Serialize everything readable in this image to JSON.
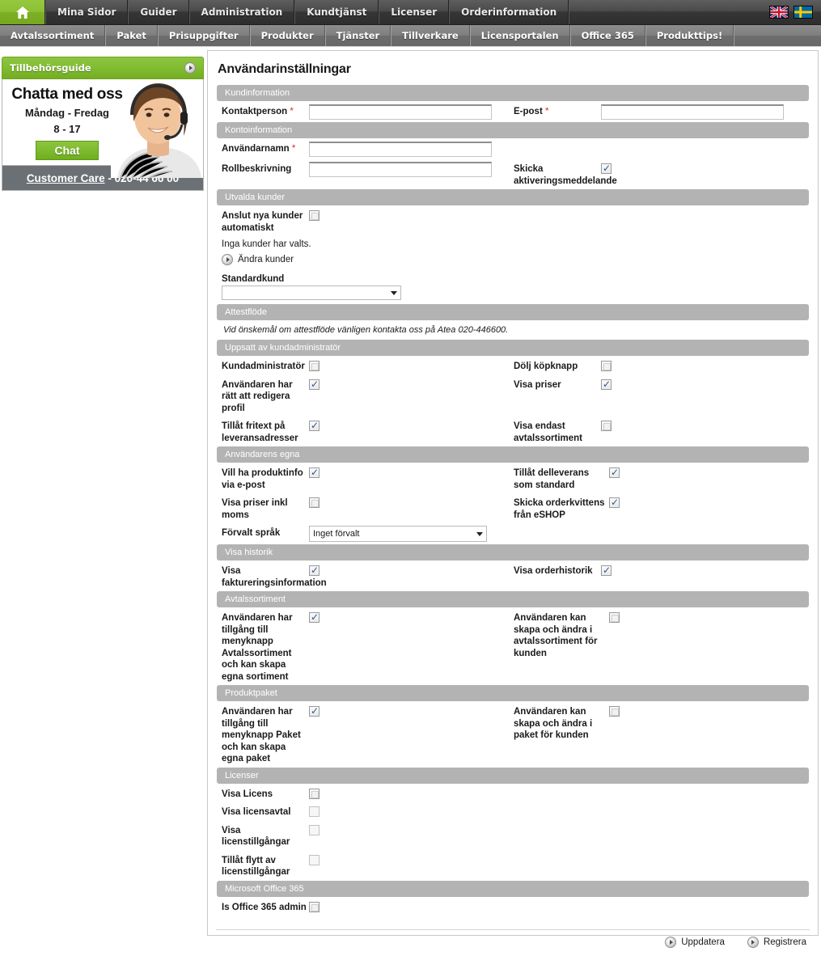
{
  "topnav": {
    "home_icon": "home-icon",
    "items": [
      {
        "label": "Mina Sidor"
      },
      {
        "label": "Guider"
      },
      {
        "label": "Administration"
      },
      {
        "label": "Kundtjänst"
      },
      {
        "label": "Licenser"
      },
      {
        "label": "Orderinformation"
      }
    ],
    "flags": [
      {
        "name": "uk-flag",
        "alt": "English"
      },
      {
        "name": "se-flag",
        "alt": "Svenska"
      }
    ]
  },
  "subnav": {
    "items": [
      {
        "label": "Avtalssortiment"
      },
      {
        "label": "Paket"
      },
      {
        "label": "Prisuppgifter"
      },
      {
        "label": "Produkter"
      },
      {
        "label": "Tjänster"
      },
      {
        "label": "Tillverkare"
      },
      {
        "label": "Licensportalen"
      },
      {
        "label": "Office 365"
      },
      {
        "label": "Produkttips!"
      }
    ]
  },
  "sidebar": {
    "guide": {
      "label": "Tillbehörsguide",
      "arrow_icon": "arrow-right-circle-icon"
    },
    "chat": {
      "title": "Chatta med oss",
      "days": "Måndag - Fredag",
      "hours": "8 - 17",
      "button": "Chat",
      "photo_alt": "support-agent-photo"
    },
    "care": {
      "link": "Customer Care",
      "sep": " - ",
      "phone": "020-44 66 00"
    }
  },
  "main": {
    "title": "Användarinställningar",
    "sections": {
      "kundinformation": {
        "header": "Kundinformation",
        "kontaktperson_label": "Kontaktperson",
        "kontaktperson_value": "",
        "epost_label": "E-post",
        "epost_value": "",
        "required_mark": "*"
      },
      "kontoinformation": {
        "header": "Kontoinformation",
        "anvandarnamn_label": "Användarnamn",
        "anvandarnamn_value": "",
        "rollbeskrivning_label": "Rollbeskrivning",
        "rollbeskrivning_value": "",
        "skicka_label": "Skicka aktiveringsmeddelande",
        "skicka_checked": true
      },
      "utvalda_kunder": {
        "header": "Utvalda kunder",
        "anslut_label": "Anslut nya kunder automatiskt",
        "anslut_checked": false,
        "inga_kunder": "Inga kunder har valts.",
        "andra_kunder": "Ändra kunder",
        "standardkund_label": "Standardkund",
        "standardkund_value": ""
      },
      "attestflode": {
        "header": "Attestflöde",
        "note": "Vid önskemål om attestflöde vänligen kontakta oss på Atea 020-446600."
      },
      "uppsatt": {
        "header": "Uppsatt av kundadministratör",
        "rows": [
          {
            "left_label": "Kundadministratör",
            "left_checked": false,
            "right_label": "Dölj köpknapp",
            "right_checked": false
          },
          {
            "left_label": "Användaren har rätt att redigera profil",
            "left_checked": true,
            "right_label": "Visa priser",
            "right_checked": true
          },
          {
            "left_label": "Tillåt fritext på leveransadresser",
            "left_checked": true,
            "right_label": "Visa endast avtalssortiment",
            "right_checked": false
          }
        ]
      },
      "anvandarens_egna": {
        "header": "Användarens egna",
        "rows": [
          {
            "left_label": "Vill ha produktinfo via e-post",
            "left_checked": true,
            "right_label": "Tillåt delleverans som standard",
            "right_checked": true
          },
          {
            "left_label": "Visa priser inkl moms",
            "left_checked": false,
            "right_label": "Skicka orderkvittens från eSHOP",
            "right_checked": true
          }
        ],
        "sprak_label": "Förvalt språk",
        "sprak_value": "Inget förvalt"
      },
      "visa_historik": {
        "header": "Visa historik",
        "rows": [
          {
            "left_label": "Visa faktureringsinformation",
            "left_checked": true,
            "right_label": "Visa orderhistorik",
            "right_checked": true
          }
        ]
      },
      "avtalssortiment": {
        "header": "Avtalssortiment",
        "rows": [
          {
            "left_label": "Användaren har tillgång till menyknapp Avtalssortiment och kan skapa egna sortiment",
            "left_checked": true,
            "right_label": "Användaren kan skapa och ändra i avtalssortiment för kunden",
            "right_checked": false
          }
        ]
      },
      "produktpaket": {
        "header": "Produktpaket",
        "rows": [
          {
            "left_label": "Användaren har tillgång till menyknapp Paket och kan skapa egna paket",
            "left_checked": true,
            "right_label": "Användaren kan skapa och ändra i paket för kunden",
            "right_checked": false
          }
        ]
      },
      "licenser": {
        "header": "Licenser",
        "rows": [
          {
            "left_label": "Visa Licens",
            "left_checked": false
          },
          {
            "left_label": "Visa licensavtal",
            "left_checked": false
          },
          {
            "left_label": "Visa licenstillgångar",
            "left_checked": false
          },
          {
            "left_label": "Tillåt flytt av licenstillgångar",
            "left_checked": false
          }
        ]
      },
      "office365": {
        "header": "Microsoft Office 365",
        "rows": [
          {
            "left_label": "Is Office 365 admin",
            "left_checked": false
          }
        ]
      }
    },
    "footer": {
      "uppdatera": "Uppdatera",
      "registrera": "Registrera",
      "icon": "arrow-right-circle-icon"
    }
  },
  "colors": {
    "brand_green": "#8cc63f",
    "nav_dark": "#4a4a4a",
    "section_gray": "#b3b3b3",
    "check_blue": "#2b5797",
    "required_red": "#d03030"
  }
}
